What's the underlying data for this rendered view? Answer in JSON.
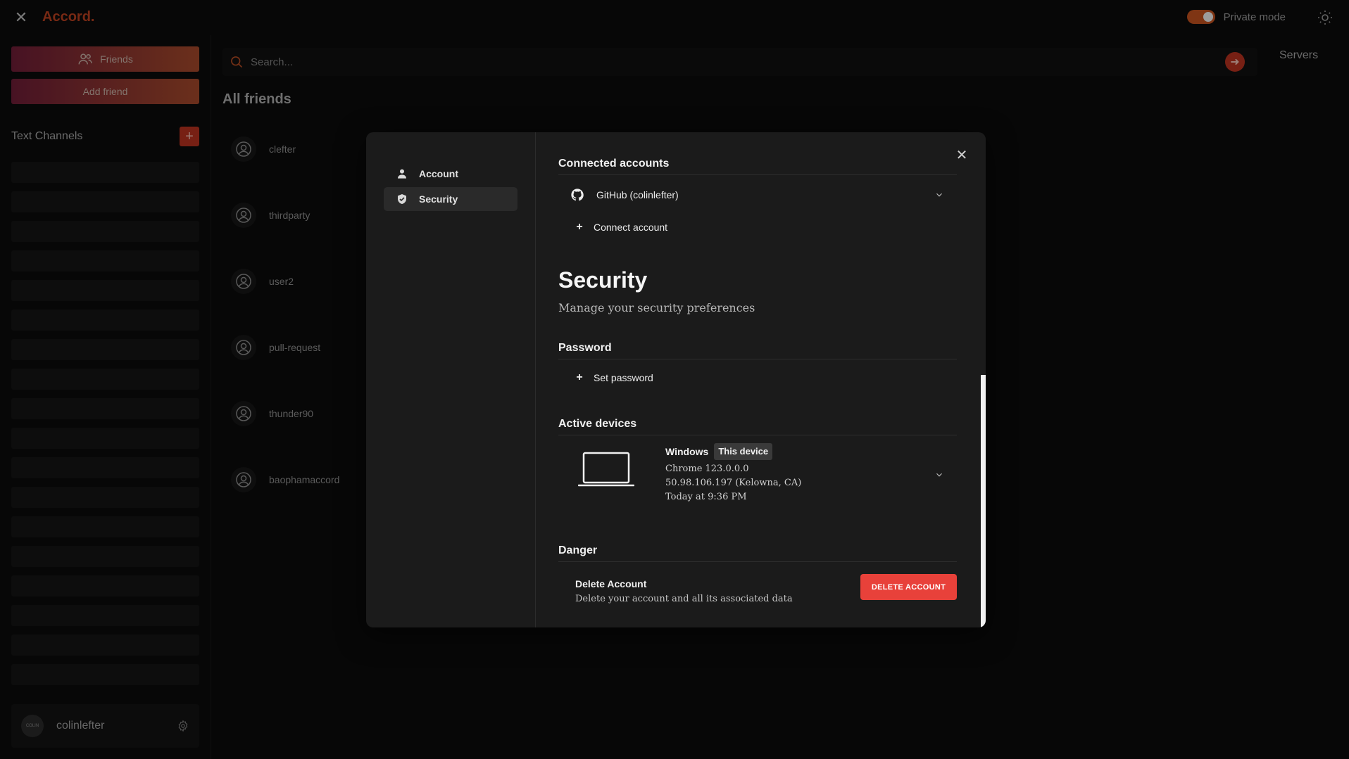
{
  "app": {
    "brand": "Accord.",
    "private_mode_label": "Private mode",
    "private_mode_on": true
  },
  "sidebar": {
    "friends_button": "Friends",
    "add_friend_button": "Add friend",
    "text_channels_title": "Text Channels",
    "add_channel_label": "+",
    "user": {
      "name": "colinlefter",
      "avatar_text": "COLIN"
    }
  },
  "main": {
    "search_placeholder": "Search...",
    "servers_label": "Servers",
    "all_friends_title": "All friends",
    "friends": [
      "clefter",
      "thirdparty",
      "user2",
      "pull-request",
      "thunder90",
      "baophamaccord"
    ]
  },
  "modal": {
    "nav": [
      {
        "label": "Account",
        "icon": "person-icon",
        "active": false
      },
      {
        "label": "Security",
        "icon": "shield-icon",
        "active": true
      }
    ],
    "connected_accounts": {
      "title": "Connected accounts",
      "github_label": "GitHub (colinlefter)",
      "connect_label": "Connect account"
    },
    "security": {
      "title": "Security",
      "subtitle": "Manage your security preferences"
    },
    "password": {
      "title": "Password",
      "set_label": "Set password"
    },
    "active_devices": {
      "title": "Active devices",
      "device": {
        "os": "Windows",
        "badge": "This device",
        "browser": "Chrome 123.0.0.0",
        "ip": "50.98.106.197 (Kelowna, CA)",
        "time": "Today at 9:36 PM"
      }
    },
    "danger": {
      "title": "Danger",
      "delete_title": "Delete Account",
      "delete_desc": "Delete your account and all its associated data",
      "delete_button": "DELETE ACCOUNT"
    }
  },
  "colors": {
    "accent": "#b7321f",
    "danger": "#e8413a",
    "modal_bg": "#1b1b1b"
  }
}
